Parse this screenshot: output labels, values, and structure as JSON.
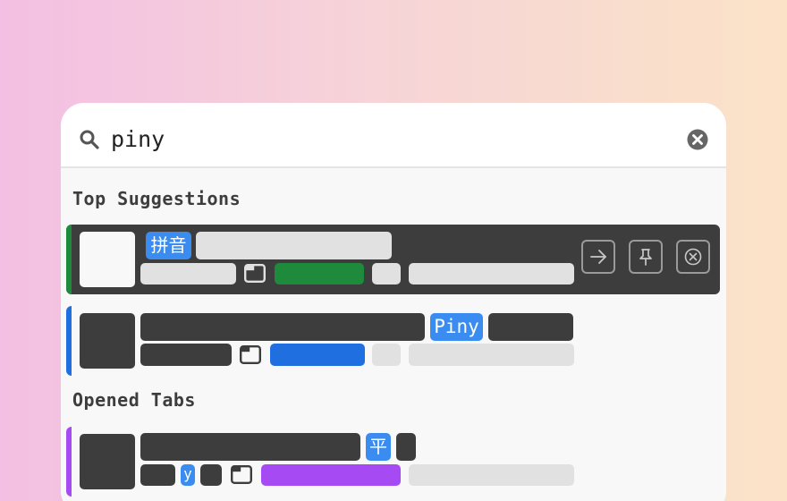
{
  "search": {
    "query": "piny"
  },
  "sections": {
    "top_suggestions": "Top Suggestions",
    "opened_tabs": "Opened Tabs"
  },
  "results": [
    {
      "highlight": "拼音",
      "accent_color": "#1e8a3c",
      "badge_color": "#1e8a3c",
      "actions": [
        "arrow-right-icon",
        "pin-icon",
        "close-circle-icon"
      ]
    },
    {
      "highlight": "Piny",
      "accent_color": "#1f6fe0",
      "badge_color": "#1f6fe0"
    },
    {
      "highlight": "平",
      "highlight_secondary": "y",
      "accent_color": "#a64bf4",
      "badge_color": "#a64bf4"
    }
  ],
  "colors": {
    "highlight_tag": "#3a8cf0",
    "selected_row": "#3d3d3d",
    "redacted_dark": "#3d3d3d",
    "redacted_light": "#e1e1e1"
  }
}
